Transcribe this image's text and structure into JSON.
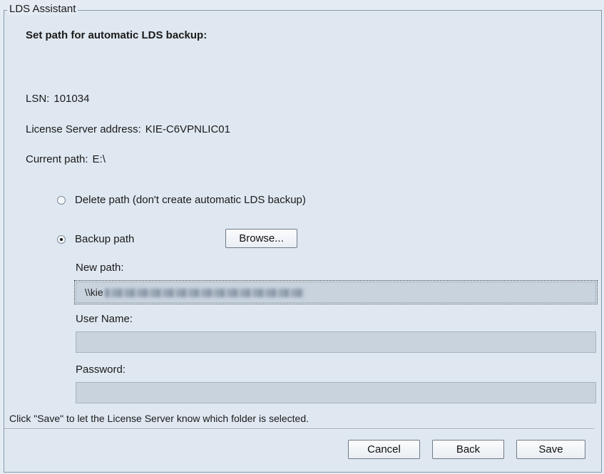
{
  "window": {
    "title": "LDS Assistant"
  },
  "heading": "Set path for automatic LDS backup:",
  "info": {
    "lsn_label": "LSN:",
    "lsn_value": "101034",
    "server_label": "License Server address:",
    "server_value": "KIE-C6VPNLIC01",
    "path_label": "Current path:",
    "path_value": "E:\\"
  },
  "options": {
    "delete_label": "Delete path (don't create automatic LDS backup)",
    "backup_label": "Backup path",
    "selected": "backup"
  },
  "browse_label": "Browse...",
  "fields": {
    "new_path_label": "New path:",
    "new_path_value": "\\\\kie",
    "user_name_label": "User Name:",
    "user_name_value": "",
    "password_label": "Password:",
    "password_value": ""
  },
  "footer_text": "Click \"Save\" to let the License Server know which folder is selected.",
  "buttons": {
    "cancel": "Cancel",
    "back": "Back",
    "save": "Save"
  }
}
